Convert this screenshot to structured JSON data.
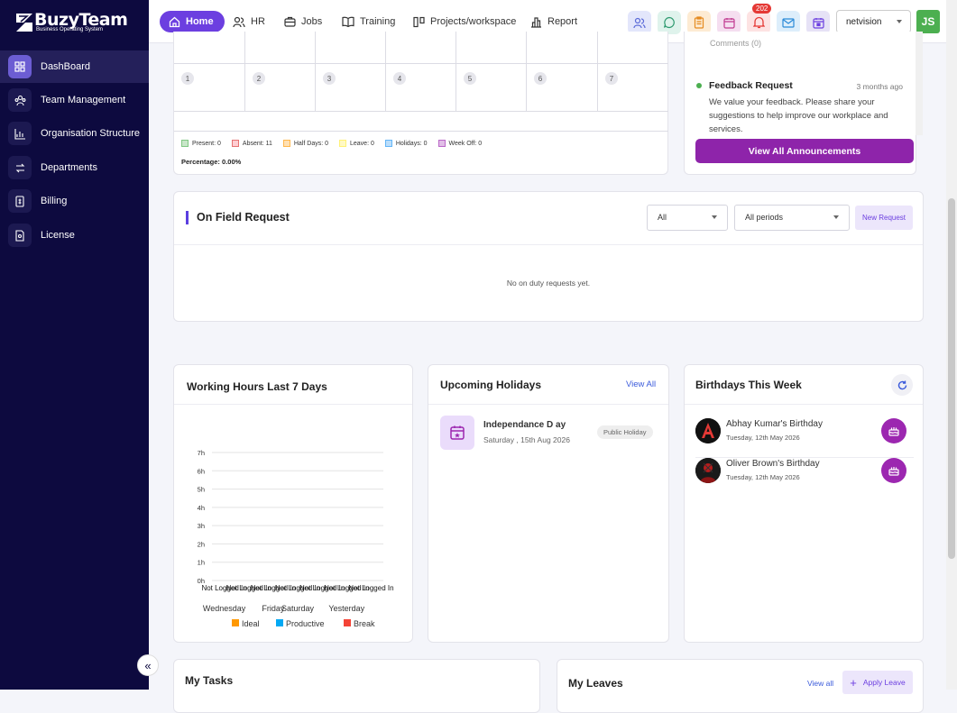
{
  "brand": {
    "name": "BuzyTeam",
    "tagline": "Business Operating System"
  },
  "sidebar": {
    "items": [
      {
        "label": "DashBoard",
        "icon": "dashboard-icon",
        "active": true
      },
      {
        "label": "Team Management",
        "icon": "team-icon",
        "active": false
      },
      {
        "label": "Organisation Structure",
        "icon": "org-chart-icon",
        "active": false
      },
      {
        "label": "Departments",
        "icon": "departments-icon",
        "active": false
      },
      {
        "label": "Billing",
        "icon": "billing-icon",
        "active": false
      },
      {
        "label": "License",
        "icon": "license-icon",
        "active": false
      }
    ],
    "collapse_label": "«"
  },
  "topnav": {
    "home": "Home",
    "hr": "HR",
    "jobs": "Jobs",
    "training": "Training",
    "projects": "Projects/workspace",
    "report": "Report",
    "notification_count": "202",
    "org": "netvision",
    "user_initials": "JS"
  },
  "calendar": {
    "days": [
      "1",
      "2",
      "3",
      "4",
      "5",
      "6",
      "7"
    ],
    "legend": [
      {
        "label": "Present: 0",
        "color": "#c8e6c9",
        "border": "#81c784"
      },
      {
        "label": "Absent: 11",
        "color": "#ffcdd2",
        "border": "#e57373"
      },
      {
        "label": "Half Days: 0",
        "color": "#ffe0b2",
        "border": "#ffb74d"
      },
      {
        "label": "Leave: 0",
        "color": "#fff9c4",
        "border": "#fff176"
      },
      {
        "label": "Holidays: 0",
        "color": "#bbdefb",
        "border": "#64b5f6"
      },
      {
        "label": "Week Off: 0",
        "color": "#e1bee7",
        "border": "#ba68c8"
      }
    ],
    "percentage": "Percentage: 0.00%"
  },
  "announcements": {
    "comments": "Comments (0)",
    "item_title": "Feedback Request",
    "item_time": "3 months ago",
    "item_body": "We value your feedback. Please share your suggestions to help improve our workplace and services.",
    "view_all": "View All Announcements"
  },
  "on_field": {
    "title": "On Field Request",
    "filter_status": "All",
    "filter_period": "All periods",
    "new_request": "New Request",
    "empty": "No on duty requests yet."
  },
  "working_hours": {
    "title": "Working Hours Last 7 Days"
  },
  "chart_data": {
    "type": "bar",
    "title": "Working Hours Last 7 Days",
    "categories": [
      "Wednesday",
      "",
      "Friday",
      "Saturday",
      "",
      "Yesterday",
      ""
    ],
    "bar_labels": [
      "Not Logged In",
      "Not Logged In",
      "Not Logged In",
      "Not Logged In",
      "Not Logged In",
      "Not Logged In",
      "Not Logged In"
    ],
    "y_ticks": [
      "0h",
      "1h",
      "2h",
      "3h",
      "4h",
      "5h",
      "6h",
      "7h"
    ],
    "ylim": [
      0,
      7
    ],
    "series": [
      {
        "name": "Ideal",
        "color": "#ff9800",
        "values": [
          0,
          0,
          0,
          0,
          0,
          0,
          0
        ]
      },
      {
        "name": "Productive",
        "color": "#03a9f4",
        "values": [
          0,
          0,
          0,
          0,
          0,
          0,
          0
        ]
      },
      {
        "name": "Break",
        "color": "#f44336",
        "values": [
          0,
          0,
          0,
          0,
          0,
          0,
          0
        ]
      }
    ],
    "grid": true,
    "legend": "bottom"
  },
  "holidays": {
    "title": "Upcoming Holidays",
    "view_all": "View All",
    "name": "Independance D ay",
    "date": "Saturday , 15th Aug 2026",
    "badge": "Public Holiday"
  },
  "birthdays": {
    "title": "Birthdays This Week",
    "items": [
      {
        "name": "Abhay Kumar's Birthday",
        "date": "Tuesday, 12th May 2026"
      },
      {
        "name": "Oliver Brown's Birthday",
        "date": "Tuesday, 12th May 2026"
      }
    ]
  },
  "tasks": {
    "title": "My Tasks"
  },
  "leaves": {
    "title": "My Leaves",
    "view_all": "View all",
    "apply": "Apply Leave"
  }
}
